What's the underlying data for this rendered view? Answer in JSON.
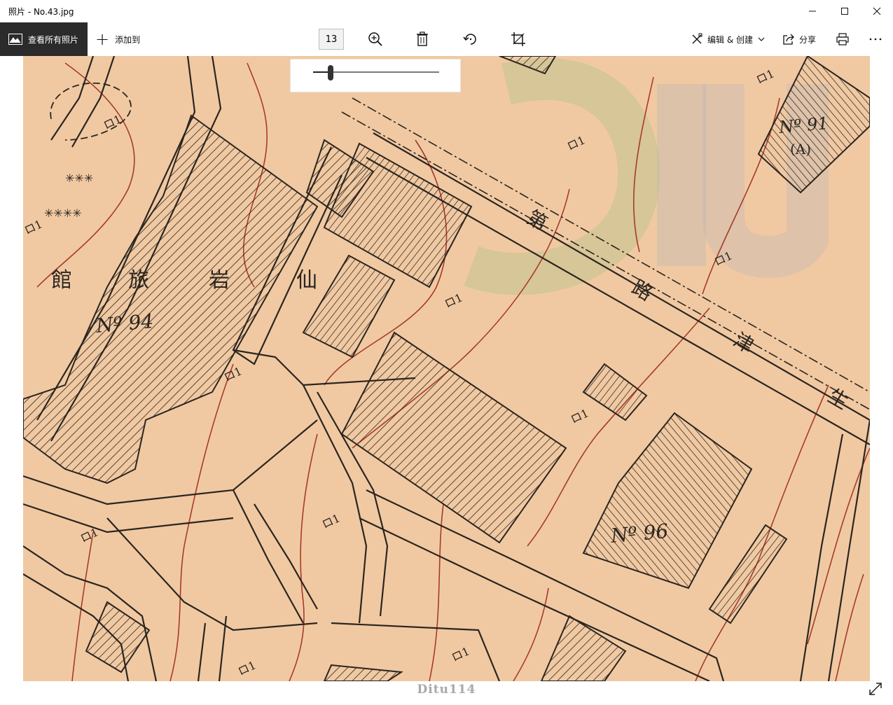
{
  "window": {
    "title": "照片 - No.43.jpg",
    "controls": [
      "minimize-icon",
      "maximize-icon",
      "close-icon"
    ]
  },
  "toolbar": {
    "view_all_label": "查看所有照片",
    "add_to_label": "添加到",
    "zoom_value": "13",
    "edit_create_label": "编辑 & 创建",
    "share_label": "分享",
    "icons": [
      "zoom-in-icon",
      "delete-icon",
      "rotate-icon",
      "crop-icon",
      "print-icon",
      "more-icon"
    ]
  },
  "zoom_slider": {
    "level": 0.14
  },
  "map": {
    "labels": {
      "hotel_name": [
        "館",
        "旅",
        "岩",
        "仙"
      ],
      "road_name": [
        "第",
        "路",
        "津",
        "生"
      ],
      "lot_94": "Nº 94",
      "lot_96": "Nº 96",
      "lot_91": "Nº 91",
      "lot_91_sub": "(A)",
      "ro1": "ロ1"
    }
  },
  "footer": {
    "watermark": "Ditu114"
  },
  "colors": {
    "map_paper": "#f0c9a2",
    "ink": "#2b2520",
    "contour": "#a83a2a",
    "toolbar_dark": "#2b2b2b"
  }
}
